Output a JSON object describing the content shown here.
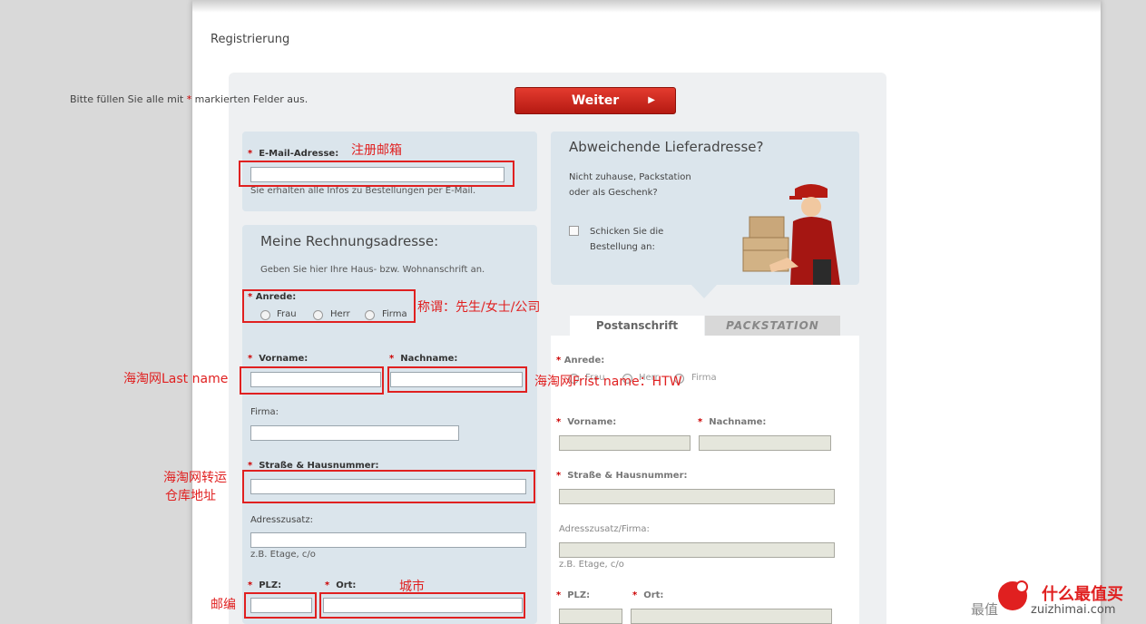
{
  "page": {
    "title": "Registrierung"
  },
  "hint": {
    "prefix": "Bitte füllen Sie alle mit ",
    "star": "*",
    "suffix": " markierten Felder aus."
  },
  "toolbar": {
    "weiter_label": "Weiter",
    "weiter_arrow": "▶"
  },
  "required_star": "*",
  "email": {
    "label": "E-Mail-Adresse:",
    "help": "Sie erhalten alle Infos zu Bestellungen per E-Mail.",
    "value": ""
  },
  "billing": {
    "heading": "Meine Rechnungsadresse:",
    "intro": "Geben Sie hier Ihre Haus- bzw. Wohnanschrift an.",
    "anrede_label": "Anrede:",
    "anrede_options": [
      "Frau",
      "Herr",
      "Firma"
    ],
    "vorname_label": "Vorname:",
    "nachname_label": "Nachname:",
    "firma_label": "Firma:",
    "strasse_label": "Straße & Hausnummer:",
    "zusatz_label": "Adresszusatz:",
    "zusatz_help": "z.B. Etage, c/o",
    "plz_label": "PLZ:",
    "ort_label": "Ort:"
  },
  "delivery": {
    "heading": "Abweichende Lieferadresse?",
    "line1": "Nicht zuhause, Packstation",
    "line2": "oder als Geschenk?",
    "checkbox_line1": "Schicken Sie die",
    "checkbox_line2": "Bestellung an:",
    "tabs": [
      "Postanschrift",
      "PACKSTATION"
    ],
    "anrede_label": "Anrede:",
    "anrede_options": [
      "Frau",
      "Herr",
      "Firma"
    ],
    "vorname_label": "Vorname:",
    "nachname_label": "Nachname:",
    "strasse_label": "Straße & Hausnummer:",
    "zusatz_label": "Adresszusatz/Firma:",
    "zusatz_help": "z.B. Etage, c/o",
    "plz_label": "PLZ:",
    "ort_label": "Ort:"
  },
  "annotations": {
    "email": "注册邮箱",
    "anrede": "称谓：先生/女士/公司",
    "lastname": "海淘网Last name",
    "firstname": "海淘网Frist name：HTW",
    "street_1": "海淘网转运",
    "street_2": "仓库地址",
    "plz": "邮编",
    "ort": "城市"
  },
  "watermark": {
    "text": "什么最值买",
    "prefix": "最值",
    "url": "zuizhimai.com"
  },
  "colors": {
    "accent": "#c8281e",
    "panel": "#dbe5ec",
    "annotation": "#e02020"
  }
}
